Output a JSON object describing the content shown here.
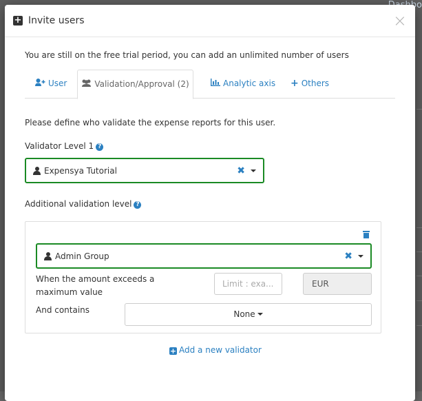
{
  "background": {
    "hint": "Dashbo"
  },
  "modal": {
    "title": "Invite users",
    "close": "×",
    "info": "You are still on the free trial period, you can add an unlimited number of users"
  },
  "tabs": [
    {
      "label": "User",
      "icon": "user-plus-icon"
    },
    {
      "label": "Validation/Approval (2)",
      "icon": "users-icon"
    },
    {
      "label": "Analytic axis",
      "icon": "bar-chart-icon"
    },
    {
      "label": "Others",
      "icon": "plus-icon"
    }
  ],
  "validation": {
    "description": "Please define who validate the expense reports for this user.",
    "level1_label": "Validator Level 1",
    "level1_value": "Expensya Tutorial",
    "additional_label": "Additional validation level",
    "additional_value": "Admin Group",
    "amount_label": "When the amount exceeds a maximum value",
    "amount_placeholder": "Limit : exa...",
    "currency": "EUR",
    "contains_label": "And contains",
    "contains_value": "None",
    "add_validator": "Add a new validator"
  },
  "colors": {
    "accent": "#2b80c1",
    "valid_border": "#1a8a24"
  }
}
